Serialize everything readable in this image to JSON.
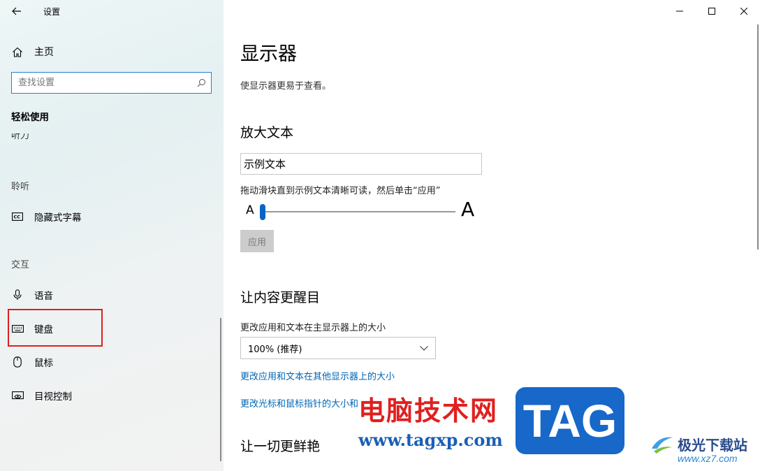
{
  "window": {
    "title": "设置"
  },
  "sidebar": {
    "home_label": "主页",
    "search_placeholder": "查找设置",
    "section_title": "轻松使用",
    "cut_item": "听力",
    "groups": {
      "hearing": "聆听",
      "interaction": "交互"
    },
    "items": [
      {
        "label": "隐藏式字幕",
        "icon": "closed-caption-icon"
      },
      {
        "label": "语音",
        "icon": "microphone-icon"
      },
      {
        "label": "键盘",
        "icon": "keyboard-icon"
      },
      {
        "label": "鼠标",
        "icon": "mouse-icon"
      },
      {
        "label": "目视控制",
        "icon": "eye-control-icon"
      }
    ]
  },
  "main": {
    "title": "显示器",
    "subtitle": "使显示器更易于查看。",
    "enlarge": {
      "heading": "放大文本",
      "sample_text": "示例文本",
      "hint": "拖动滑块直到示例文本清晰可读，然后单击“应用”",
      "a_small": "A",
      "a_large": "A",
      "slider_value_percent": 0,
      "apply_label": "应用"
    },
    "bright": {
      "heading": "让内容更醒目",
      "size_label": "更改应用和文本在主显示器上的大小",
      "size_selected": "100% (推荐)",
      "link_other": "更改应用和文本在其他显示器上的大小",
      "link_cursor": "更改光标和鼠标指针的大小和"
    },
    "vivid_heading": "让一切更鲜艳"
  },
  "watermark": {
    "cn": "电脑技术网",
    "url": "www.tagxp.com",
    "tag": "TAG",
    "site": "极光下载站",
    "site_url": "www.xz7.com"
  },
  "colors": {
    "accent": "#0a64c8",
    "link": "#0066b4",
    "highlight": "#e01e1e"
  }
}
